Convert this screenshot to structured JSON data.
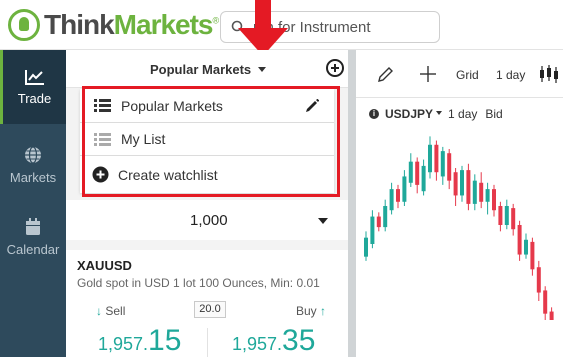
{
  "app": {
    "brand_think": "Think",
    "brand_markets": "Markets",
    "brand_reg": "®"
  },
  "search": {
    "visible_text": "rch for Instrument",
    "icon": "search-icon"
  },
  "nav": {
    "items": [
      {
        "label": "Trade",
        "icon": "line-chart-icon",
        "active": true
      },
      {
        "label": "Markets",
        "icon": "globe-icon",
        "active": false
      },
      {
        "label": "Calendar",
        "icon": "calendar-icon",
        "active": false
      }
    ]
  },
  "watchlist": {
    "title": "Popular Markets",
    "menu": {
      "popular": "Popular Markets",
      "mylist": "My List",
      "create": "Create watchlist"
    }
  },
  "quantity": {
    "value": "1,000"
  },
  "instrument": {
    "symbol": "XAUUSD",
    "description": "Gold spot in USD 1 lot 100 Ounces, Min: 0.01",
    "sell_label": "Sell",
    "buy_label": "Buy",
    "spread": "20.0",
    "sell_price_main": "1,957.",
    "sell_price_big": "15",
    "buy_price_main": "1,957.",
    "buy_price_big": "35"
  },
  "chart_toolbar": {
    "grid": "Grid",
    "period": "1 day"
  },
  "chart_header": {
    "symbol": "USDJPY",
    "period": "1 day",
    "side": "Bid"
  },
  "colors": {
    "accent_green": "#6db33f",
    "nav_bg": "#2e4a5c",
    "price_teal": "#1fa89a",
    "candle_up": "#1fa89a",
    "candle_down": "#e5394b",
    "highlight_red": "#e41a24"
  },
  "chart_candles": [
    {
      "dir": "up",
      "o": 60,
      "c": 78,
      "h": 84,
      "l": 56
    },
    {
      "dir": "up",
      "o": 72,
      "c": 98,
      "h": 104,
      "l": 68
    },
    {
      "dir": "down",
      "o": 98,
      "c": 88,
      "h": 102,
      "l": 84
    },
    {
      "dir": "up",
      "o": 88,
      "c": 108,
      "h": 114,
      "l": 84
    },
    {
      "dir": "up",
      "o": 104,
      "c": 124,
      "h": 130,
      "l": 100
    },
    {
      "dir": "down",
      "o": 124,
      "c": 112,
      "h": 128,
      "l": 106
    },
    {
      "dir": "up",
      "o": 112,
      "c": 136,
      "h": 142,
      "l": 108
    },
    {
      "dir": "up",
      "o": 130,
      "c": 150,
      "h": 158,
      "l": 126
    },
    {
      "dir": "down",
      "o": 150,
      "c": 128,
      "h": 154,
      "l": 120
    },
    {
      "dir": "up",
      "o": 122,
      "c": 146,
      "h": 152,
      "l": 118
    },
    {
      "dir": "up",
      "o": 140,
      "c": 166,
      "h": 174,
      "l": 134
    },
    {
      "dir": "down",
      "o": 166,
      "c": 140,
      "h": 170,
      "l": 132
    },
    {
      "dir": "up",
      "o": 136,
      "c": 160,
      "h": 164,
      "l": 128
    },
    {
      "dir": "down",
      "o": 158,
      "c": 132,
      "h": 162,
      "l": 124
    },
    {
      "dir": "down",
      "o": 140,
      "c": 118,
      "h": 144,
      "l": 108
    },
    {
      "dir": "up",
      "o": 118,
      "c": 142,
      "h": 146,
      "l": 112
    },
    {
      "dir": "down",
      "o": 142,
      "c": 110,
      "h": 148,
      "l": 104
    },
    {
      "dir": "up",
      "o": 110,
      "c": 132,
      "h": 138,
      "l": 104
    },
    {
      "dir": "down",
      "o": 130,
      "c": 112,
      "h": 140,
      "l": 106
    },
    {
      "dir": "up",
      "o": 112,
      "c": 124,
      "h": 130,
      "l": 100
    },
    {
      "dir": "down",
      "o": 124,
      "c": 104,
      "h": 128,
      "l": 98
    },
    {
      "dir": "down",
      "o": 108,
      "c": 90,
      "h": 112,
      "l": 84
    },
    {
      "dir": "up",
      "o": 90,
      "c": 108,
      "h": 114,
      "l": 86
    },
    {
      "dir": "down",
      "o": 106,
      "c": 86,
      "h": 110,
      "l": 80
    },
    {
      "dir": "down",
      "o": 90,
      "c": 62,
      "h": 94,
      "l": 56
    },
    {
      "dir": "up",
      "o": 62,
      "c": 76,
      "h": 82,
      "l": 58
    },
    {
      "dir": "down",
      "o": 74,
      "c": 48,
      "h": 78,
      "l": 42
    },
    {
      "dir": "down",
      "o": 50,
      "c": 26,
      "h": 56,
      "l": 18
    },
    {
      "dir": "down",
      "o": 28,
      "c": 6,
      "h": 32,
      "l": 0
    },
    {
      "dir": "down",
      "o": 8,
      "c": 0,
      "h": 12,
      "l": 0
    }
  ]
}
